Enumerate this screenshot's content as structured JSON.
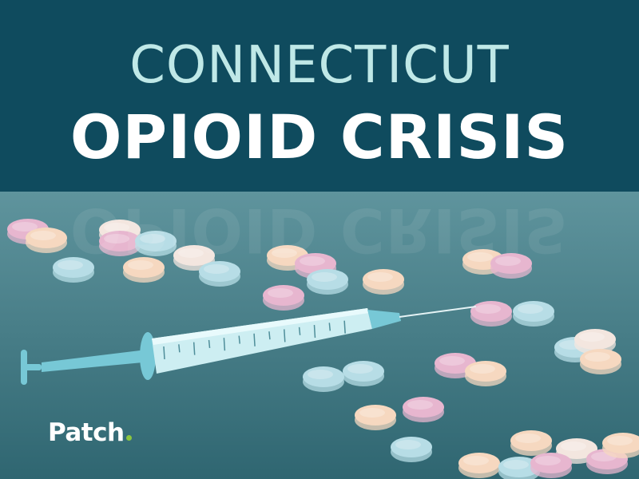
{
  "headline": {
    "line1": "CONNECTICUT",
    "line2": "OPIOID CRISIS"
  },
  "logo": {
    "text": "Patch"
  },
  "colors": {
    "header_bg": "#0f4b5e",
    "title_light": "#bfe8e7",
    "title_bold": "#ffffff",
    "scene_top": "#5f949d",
    "scene_bottom": "#2f6671",
    "pill_pink": "#e7b6cf",
    "pill_blue": "#b7dde6",
    "pill_peach": "#f6d8c0",
    "pill_cream": "#f3e6df",
    "syringe_barrel": "#cdeef2",
    "syringe_accent": "#77c8d6",
    "logo_accent": "#8cc63f"
  },
  "icons": [
    "syringe-icon",
    "pill-icon"
  ]
}
